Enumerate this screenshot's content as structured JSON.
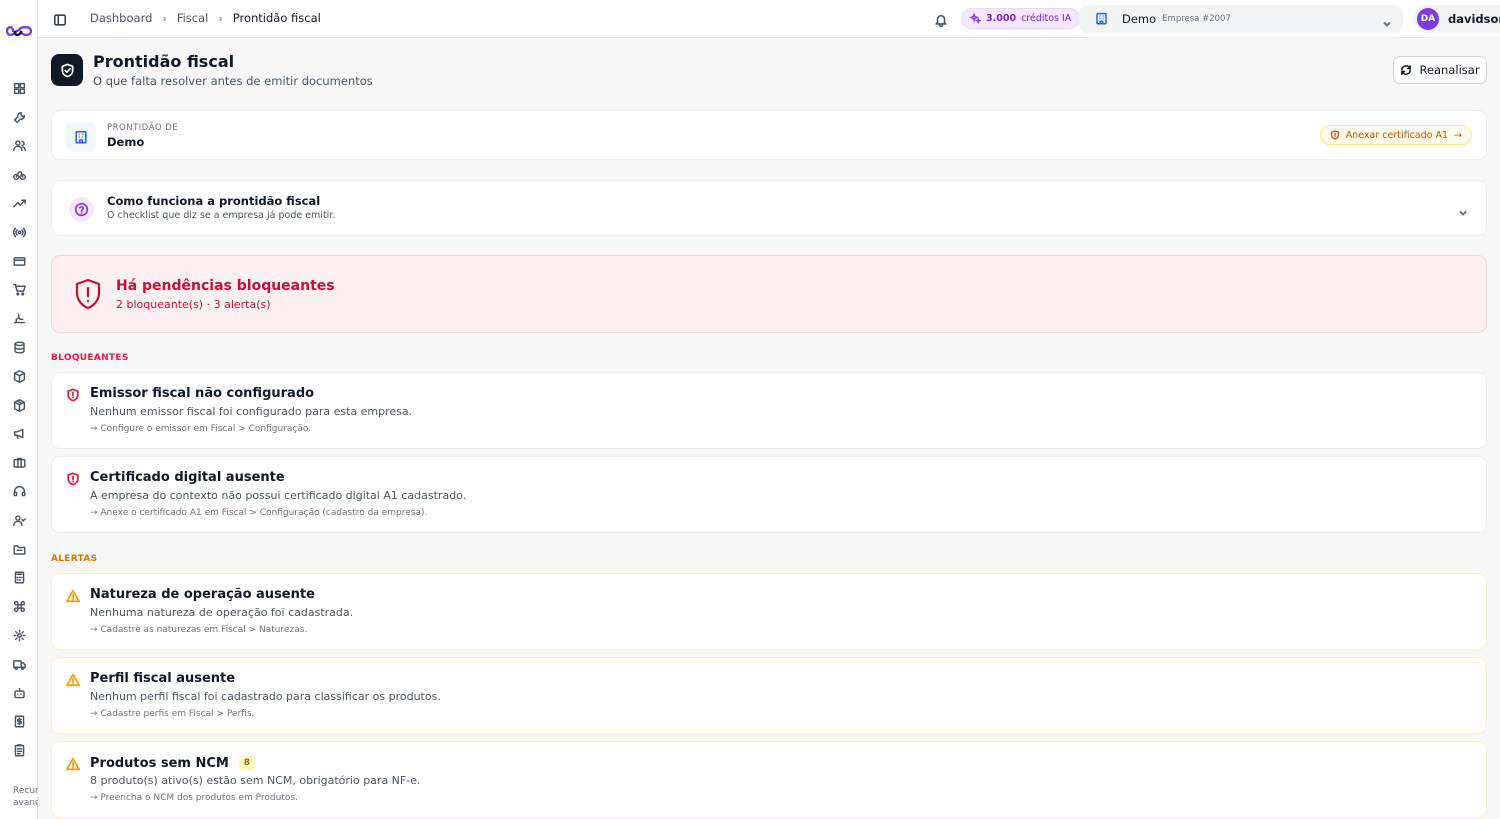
{
  "sidebar": {
    "icons": [
      "dashboard-icon",
      "wrench-icon",
      "users-icon",
      "bike-icon",
      "trending-icon",
      "radio-icon",
      "credit-card-icon",
      "cart-icon",
      "hand-icon",
      "database-icon",
      "package-icon",
      "box-icon",
      "megaphone-icon",
      "briefcase-icon",
      "headset-icon",
      "user-group-icon",
      "folder-icon",
      "calculator-icon",
      "command-icon",
      "settings-icon",
      "truck-icon",
      "bot-icon",
      "receipt-icon",
      "clipboard-icon"
    ],
    "footer_line1": "Recur",
    "footer_line2": "avanç"
  },
  "breadcrumb": {
    "items": [
      "Dashboard",
      "Fiscal"
    ],
    "current": "Prontidão fiscal",
    "separator": "›"
  },
  "credits": {
    "amount": "3.000",
    "label": "créditos IA"
  },
  "company": {
    "name": "Demo",
    "sub": "Empresa #2007"
  },
  "user": {
    "initials": "DA",
    "name": "davidson",
    "avatar_color": "#7c3aed"
  },
  "header": {
    "title": "Prontidão fiscal",
    "subtitle": "O que falta resolver antes de emitir documentos",
    "reanalyze_label": "Reanalisar"
  },
  "context": {
    "label": "PRONTIDÃO DE",
    "value": "Demo",
    "badge": "Anexar certificado A1",
    "badge_arrow": "→"
  },
  "how_it_works": {
    "title": "Como funciona a prontidão fiscal",
    "subtitle": "O checklist que diz se a empresa já pode emitir."
  },
  "status": {
    "title": "Há pendências bloqueantes",
    "summary": "2 bloqueante(s) · 3 alerta(s)",
    "color": "#be123c"
  },
  "blockers": {
    "label": "BLOQUEANTES",
    "items": [
      {
        "title": "Emissor fiscal não configurado",
        "description": "Nenhum emissor fiscal foi configurado para esta empresa.",
        "hint": "→ Configure o emissor em Fiscal > Configuração."
      },
      {
        "title": "Certificado digital ausente",
        "description": "A empresa do contexto não possui certificado digital A1 cadastrado.",
        "hint": "→ Anexe o certificado A1 em Fiscal > Configuração (cadastro da empresa)."
      }
    ]
  },
  "alerts": {
    "label": "ALERTAS",
    "items": [
      {
        "title": "Natureza de operação ausente",
        "description": "Nenhuma natureza de operação foi cadastrada.",
        "hint": "→ Cadastre as naturezas em Fiscal > Naturezas."
      },
      {
        "title": "Perfil fiscal ausente",
        "description": "Nenhum perfil fiscal foi cadastrado para classificar os produtos.",
        "hint": "→ Cadastre perfis em Fiscal > Perfis."
      },
      {
        "title": "Produtos sem NCM",
        "count": "8",
        "description": "8 produto(s) ativo(s) estão sem NCM, obrigatório para NF-e.",
        "hint": "→ Preencha o NCM dos produtos em Produtos."
      }
    ]
  }
}
